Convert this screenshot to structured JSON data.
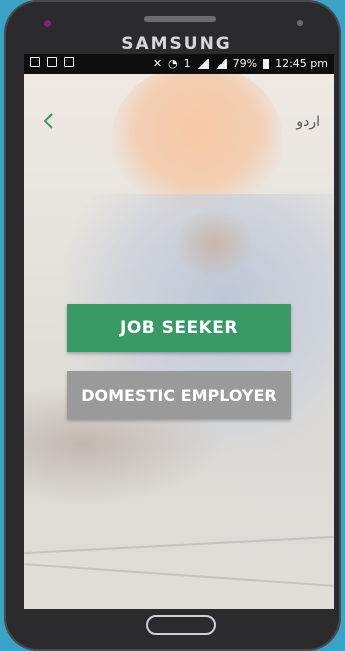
{
  "device": {
    "brand": "SAMSUNG"
  },
  "status_bar": {
    "battery": "79%",
    "time": "12:45 pm",
    "sim_slot": "1"
  },
  "header": {
    "back_icon": "chevron-left-icon",
    "language_label": "اردو"
  },
  "main": {
    "job_seeker_label": "JOB SEEKER",
    "domestic_employer_label": "DOMESTIC EMPLOYER"
  },
  "colors": {
    "primary_green": "#3a9a66",
    "secondary_gray": "#9a9a9a",
    "back_icon_color": "#3a9a66"
  }
}
